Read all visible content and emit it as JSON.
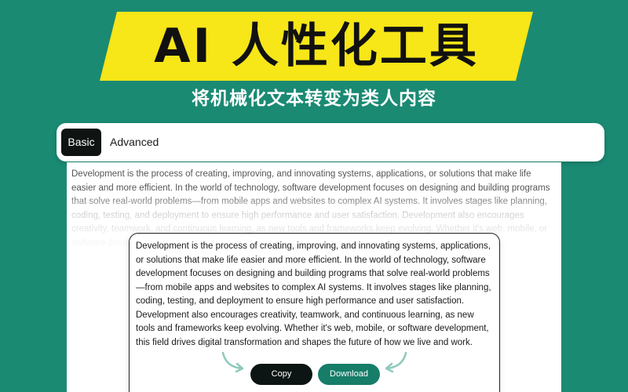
{
  "header": {
    "title": "AI 人性化工具",
    "subtitle": "将机械化文本转变为类人内容"
  },
  "tabs": [
    {
      "label": "Basic",
      "active": true
    },
    {
      "label": "Advanced",
      "active": false
    }
  ],
  "input": {
    "text": "Development is the process of creating, improving, and innovating systems, applications, or solutions that make life easier and more efficient. In the world of technology, software development focuses on designing and building programs that solve real-world problems—from mobile apps and websites to complex AI systems. It involves stages like planning, coding, testing, and deployment to ensure high performance and user satisfaction. Development also encourages creativity, teamwork, and continuous learning, as new tools and frameworks keep evolving. Whether it's web, mobile, or software development, this field drives digital transformation and shapes the future of how we live and work."
  },
  "output": {
    "text": "Development is the process of creating, improving, and innovating systems, applications, or solutions that make life easier and more efficient. In the world of technology, software development focuses on designing and building programs that solve real-world problems—from mobile apps and websites to complex AI systems. It involves stages like planning, coding, testing, and deployment to ensure high performance and user satisfaction. Development also encourages creativity, teamwork, and continuous learning, as new tools and frameworks keep evolving. Whether it's web, mobile, or software development, this field drives digital transformation and shapes the future of how we live and work."
  },
  "actions": {
    "copy_label": "Copy",
    "download_label": "Download"
  },
  "icons": {
    "left_arrow": "curved-arrow-right-icon",
    "right_arrow": "curved-arrow-left-icon"
  },
  "colors": {
    "background": "#1a8a73",
    "banner": "#f7e618",
    "active_tab": "#0f1412",
    "copy_button": "#0c1513",
    "download_button": "#167d69"
  }
}
